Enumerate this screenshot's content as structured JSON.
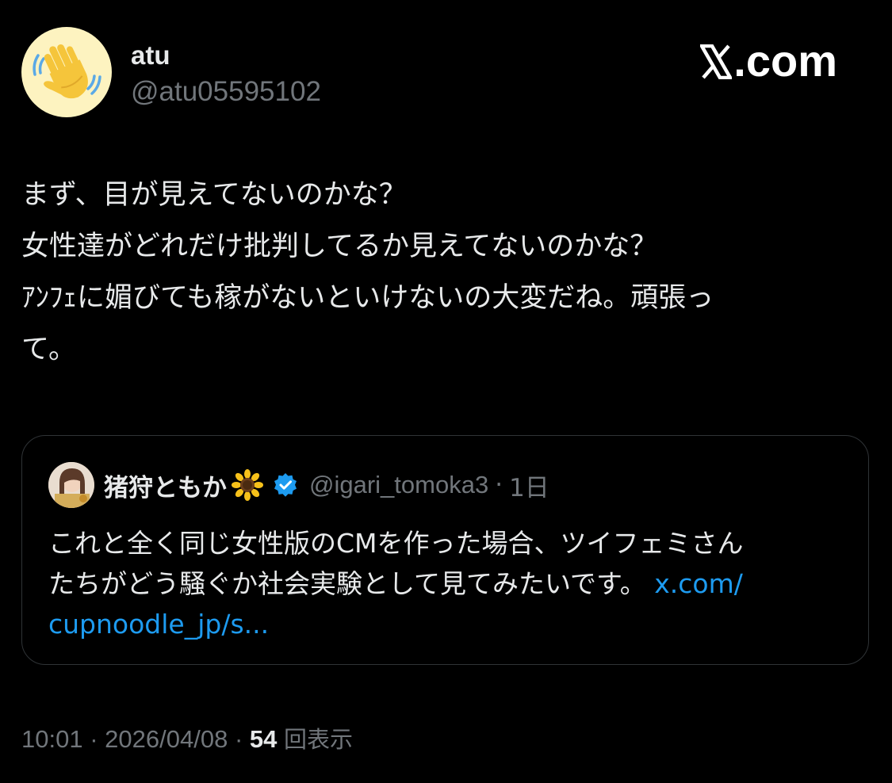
{
  "author": {
    "display_name": "atu",
    "handle": "@atu05595102",
    "avatar_icon": "waving-hand-icon",
    "avatar_bg": "#fdf3c0"
  },
  "watermark": {
    "text": ".com",
    "icon": "x-logo-icon"
  },
  "tweet": {
    "lines": [
      "まず、目が見えてないのかな？",
      "女性達がどれだけ批判してるか見えてないのかな？",
      "ｱﾝﾌｪに媚びても稼がないといけないの大変だね。頑張っ",
      "て。"
    ]
  },
  "quote": {
    "display_name": "猪狩ともか",
    "name_emoji": "🌻",
    "verified_icon": "verified-badge-icon",
    "handle": "@igari_tomoka3",
    "separator": "·",
    "time": "1日",
    "line1": "これと全く同じ女性版のCMを作った場合、ツイフェミさん",
    "line2_text": "たちがどう騒ぐか社会実験として見てみたいです。",
    "line2_link": "x.com/",
    "line3_link": "cupnoodle_jp/s..."
  },
  "meta": {
    "time": "10:01",
    "sep1": "·",
    "date": "2026/04/08",
    "sep2": "·",
    "views_count": "54",
    "views_label": "回表示"
  },
  "colors": {
    "background": "#000000",
    "text": "#e7e9ea",
    "secondary": "#71767b",
    "link": "#1d9bf0",
    "border": "#2f3336"
  }
}
